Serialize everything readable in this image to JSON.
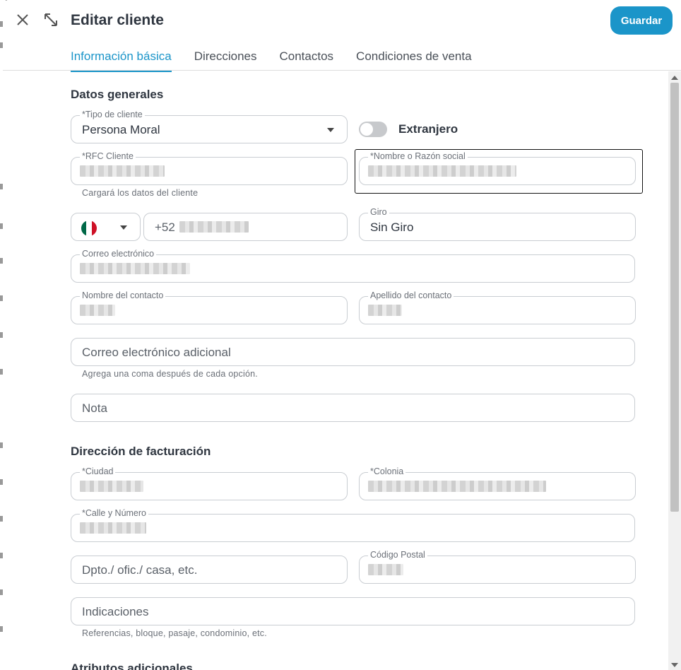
{
  "header": {
    "title": "Editar cliente",
    "save_label": "Guardar"
  },
  "tabs": [
    {
      "label": "Información básica",
      "active": true
    },
    {
      "label": "Direcciones",
      "active": false
    },
    {
      "label": "Contactos",
      "active": false
    },
    {
      "label": "Condiciones de venta",
      "active": false
    }
  ],
  "general": {
    "section_title": "Datos generales",
    "tipo_cliente": {
      "label": "*Tipo de cliente",
      "value": "Persona Moral"
    },
    "extranjero": {
      "label": "Extranjero",
      "on": false
    },
    "rfc": {
      "label": "*RFC Cliente",
      "helper": "Cargará los datos del cliente"
    },
    "razon_social": {
      "label": "*Nombre o Razón social"
    },
    "phone": {
      "prefix": "+52",
      "country_icon": "mexico-flag-icon"
    },
    "giro": {
      "label": "Giro",
      "value": "Sin Giro"
    },
    "correo": {
      "label": "Correo electrónico"
    },
    "nombre_contacto": {
      "label": "Nombre del contacto"
    },
    "apellido_contacto": {
      "label": "Apellido del contacto"
    },
    "correo_adicional": {
      "placeholder": "Correo electrónico adicional",
      "helper": "Agrega una coma después de cada opción."
    },
    "nota": {
      "placeholder": "Nota"
    }
  },
  "billing": {
    "section_title": "Dirección de facturación",
    "ciudad": {
      "label": "*Ciudad"
    },
    "colonia": {
      "label": "*Colonia"
    },
    "calle": {
      "label": "*Calle y Número"
    },
    "dpto": {
      "placeholder": "Dpto./ ofic./ casa, etc."
    },
    "cp": {
      "label": "Código Postal"
    },
    "indicaciones": {
      "placeholder": "Indicaciones",
      "helper": "Referencias, bloque, pasaje, condominio, etc."
    }
  },
  "extra": {
    "section_title": "Atributos adicionales"
  },
  "colors": {
    "accent": "#1b95c9",
    "border": "#c9cdd2",
    "text": "#2f3640"
  }
}
